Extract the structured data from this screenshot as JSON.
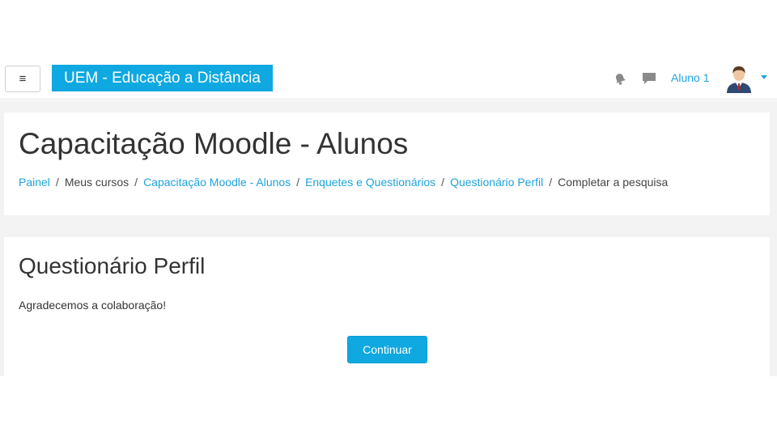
{
  "navbar": {
    "menu_icon_name": "hamburger-icon",
    "menu_glyph": "≡",
    "brand": "UEM - Educação a Distância",
    "notification_icon": "bell-icon",
    "messages_icon": "chat-icon",
    "user_name": "Aluno 1",
    "user_menu_icon": "caret-down-icon",
    "accent_color": "#0fa8e0"
  },
  "header": {
    "title": "Capacitação Moodle - Alunos",
    "breadcrumb": [
      {
        "label": "Painel",
        "link": true
      },
      {
        "label": "Meus cursos",
        "link": false
      },
      {
        "label": "Capacitação Moodle - Alunos",
        "link": true
      },
      {
        "label": "Enquetes e Questionários",
        "link": true
      },
      {
        "label": "Questionário Perfil",
        "link": true
      },
      {
        "label": "Completar a pesquisa",
        "link": false
      }
    ],
    "separator": "/"
  },
  "main": {
    "title": "Questionário Perfil",
    "message": "Agradecemos a colaboração!",
    "continue_label": "Continuar"
  }
}
